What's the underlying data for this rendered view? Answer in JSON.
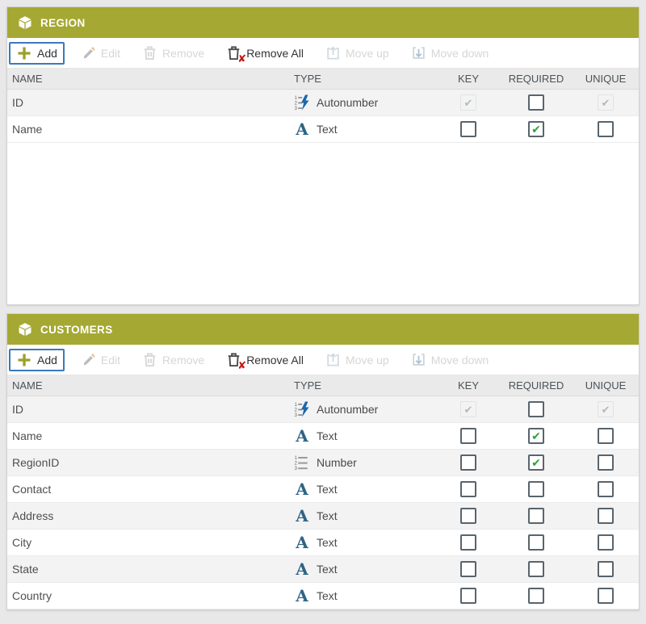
{
  "columns": [
    "NAME",
    "TYPE",
    "KEY",
    "REQUIRED",
    "UNIQUE"
  ],
  "toolbar": {
    "add": "Add",
    "edit": "Edit",
    "remove": "Remove",
    "remove_all": "Remove All",
    "move_up": "Move up",
    "move_down": "Move down"
  },
  "colors": {
    "panel_header": "#a5a832",
    "required_check": "#2ca33b",
    "text_type_icon": "#2d6484",
    "autonumber_bolt": "#1a67ae",
    "focus_outline": "#3a7ab8",
    "remove_all_x": "#c41818"
  },
  "panels": [
    {
      "title": "REGION",
      "rows": [
        {
          "name": "ID",
          "type": "Autonumber",
          "icon": "autonumber",
          "key": "on-disabled",
          "required": "off",
          "unique": "on-disabled"
        },
        {
          "name": "Name",
          "type": "Text",
          "icon": "text",
          "key": "off",
          "required": "on",
          "unique": "off"
        }
      ]
    },
    {
      "title": "CUSTOMERS",
      "rows": [
        {
          "name": "ID",
          "type": "Autonumber",
          "icon": "autonumber",
          "key": "on-disabled",
          "required": "off",
          "unique": "on-disabled"
        },
        {
          "name": "Name",
          "type": "Text",
          "icon": "text",
          "key": "off",
          "required": "on",
          "unique": "off"
        },
        {
          "name": "RegionID",
          "type": "Number",
          "icon": "number",
          "key": "off",
          "required": "on",
          "unique": "off"
        },
        {
          "name": "Contact",
          "type": "Text",
          "icon": "text",
          "key": "off",
          "required": "off",
          "unique": "off"
        },
        {
          "name": "Address",
          "type": "Text",
          "icon": "text",
          "key": "off",
          "required": "off",
          "unique": "off"
        },
        {
          "name": "City",
          "type": "Text",
          "icon": "text",
          "key": "off",
          "required": "off",
          "unique": "off"
        },
        {
          "name": "State",
          "type": "Text",
          "icon": "text",
          "key": "off",
          "required": "off",
          "unique": "off"
        },
        {
          "name": "Country",
          "type": "Text",
          "icon": "text",
          "key": "off",
          "required": "off",
          "unique": "off"
        }
      ]
    }
  ]
}
